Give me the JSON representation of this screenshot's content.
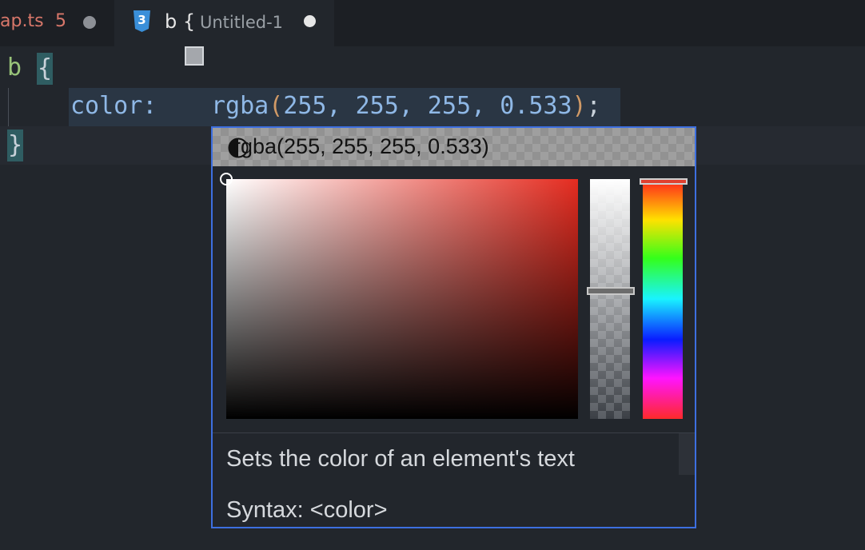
{
  "tabs": [
    {
      "name": "ap.ts",
      "problem_count": "5",
      "modified": true
    },
    {
      "name": "b {",
      "description": "Untitled-1",
      "modified": true,
      "icon": "css3-icon",
      "active": true
    }
  ],
  "editor": {
    "line1": {
      "selector": "b",
      "open_brace": "{"
    },
    "line2": {
      "property": "color:",
      "func": "rgba",
      "open_paren": "(",
      "args": "255, 255, 255, 0.533",
      "close_paren": ")",
      "semicolon": ";",
      "swatch_color": "#a4a7ac"
    },
    "line3": {
      "close_brace": "}"
    }
  },
  "color_picker": {
    "value": "rgba(255, 255, 255, 0.533)",
    "hue_color": "#e52c20",
    "opacity": 0.533,
    "mode_icon": "half-circle-icon"
  },
  "hover": {
    "description": "Sets the color of an element's text",
    "syntax": "Syntax: <color>"
  },
  "colors": {
    "accent_border": "#3d6fe0",
    "editor_bg": "#22262c",
    "keyword_green": "#98c379",
    "value_blue": "#8fb8e6",
    "paren_orange": "#d19a66"
  }
}
